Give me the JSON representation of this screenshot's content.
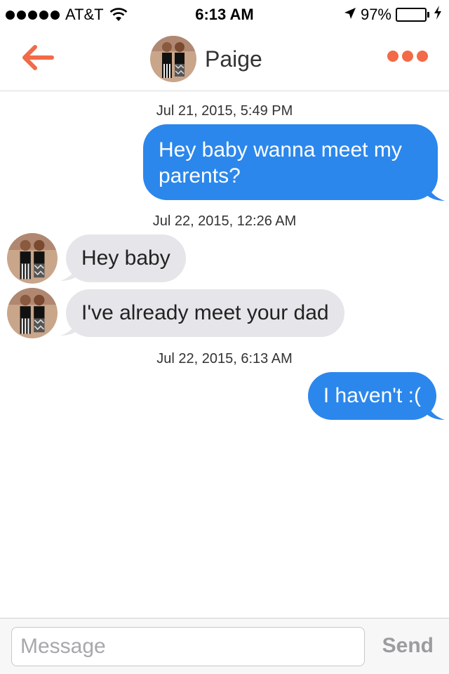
{
  "status_bar": {
    "carrier": "AT&T",
    "time": "6:13 AM",
    "battery_percent": "97%",
    "battery_level": 0.97,
    "icons": [
      "signal-dots-icon",
      "wifi-icon",
      "location-arrow-icon",
      "battery-icon",
      "charging-bolt-icon"
    ]
  },
  "header": {
    "back_icon": "back-arrow-icon",
    "contact_name": "Paige",
    "more_icon": "more-dots-icon",
    "accent_color": "#f26a47"
  },
  "conversation": {
    "timestamps": [
      "Jul 21, 2015, 5:49 PM",
      "Jul 22, 2015, 12:26 AM",
      "Jul 22, 2015, 6:13 AM"
    ],
    "messages": [
      {
        "direction": "out",
        "lines": [
          "Hey baby wanna meet my",
          "parents?"
        ]
      },
      {
        "direction": "in",
        "text": "Hey baby"
      },
      {
        "direction": "in",
        "text": "I've already meet your dad"
      },
      {
        "direction": "out",
        "text": "I haven't :("
      }
    ],
    "colors": {
      "outgoing": "#2b87ec",
      "incoming": "#e5e5ea"
    }
  },
  "composer": {
    "placeholder": "Message",
    "value": "",
    "send_label": "Send"
  }
}
